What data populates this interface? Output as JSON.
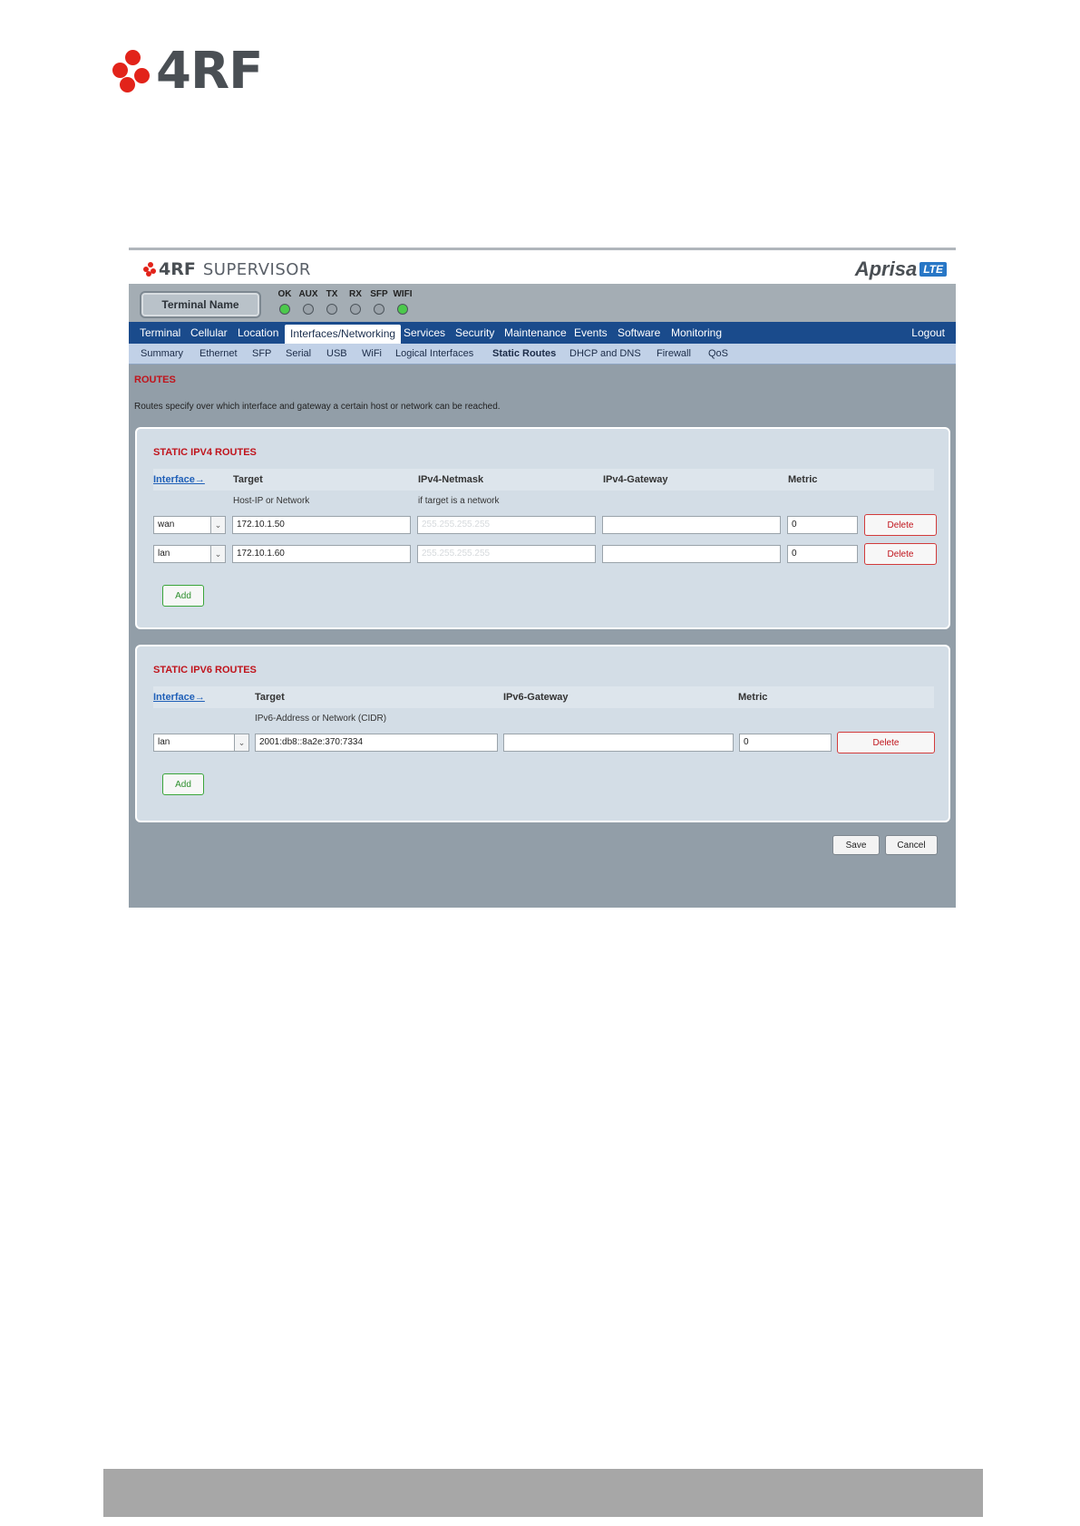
{
  "page_logo": {
    "text": "4RF"
  },
  "app": {
    "brand": "4RF",
    "product": "SUPERVISOR",
    "aprisa": "Aprisa",
    "aprisa_badge": "LTE"
  },
  "status": {
    "terminal_name": "Terminal Name",
    "leds": [
      {
        "label": "OK",
        "color": "#4cc94c"
      },
      {
        "label": "AUX",
        "color": "#9ba3aa"
      },
      {
        "label": "TX",
        "color": "#9ba3aa"
      },
      {
        "label": "RX",
        "color": "#9ba3aa"
      },
      {
        "label": "SFP",
        "color": "#9ba3aa"
      },
      {
        "label": "WIFI",
        "color": "#4cc94c"
      }
    ]
  },
  "nav": {
    "main": [
      "Terminal",
      "Cellular",
      "Location",
      "Interfaces/Networking",
      "Services",
      "Security",
      "Maintenance",
      "Events",
      "Software",
      "Monitoring"
    ],
    "logout": "Logout",
    "sub": [
      "Summary",
      "Ethernet",
      "SFP",
      "Serial",
      "USB",
      "WiFi",
      "Logical Interfaces",
      "Static Routes",
      "DHCP and DNS",
      "Firewall",
      "QoS"
    ]
  },
  "routes": {
    "title": "ROUTES",
    "description": "Routes specify over which interface and gateway a certain host or network can be reached."
  },
  "ipv4": {
    "title": "STATIC IPV4 ROUTES",
    "headers": {
      "interface": "Interface→",
      "target": "Target",
      "netmask": "IPv4-Netmask",
      "gateway": "IPv4-Gateway",
      "metric": "Metric"
    },
    "hints": {
      "target": "Host-IP or Network",
      "netmask": "if target is a network"
    },
    "rows": [
      {
        "interface": "wan",
        "target": "172.10.1.50",
        "netmask_placeholder": "255.255.255.255",
        "gateway": "",
        "metric": "0",
        "delete": "Delete"
      },
      {
        "interface": "lan",
        "target": "172.10.1.60",
        "netmask_placeholder": "255.255.255.255",
        "gateway": "",
        "metric": "0",
        "delete": "Delete"
      }
    ],
    "add": "Add"
  },
  "ipv6": {
    "title": "STATIC IPV6 ROUTES",
    "headers": {
      "interface": "Interface→",
      "target": "Target",
      "gateway": "IPv6-Gateway",
      "metric": "Metric"
    },
    "hints": {
      "target": "IPv6-Address or Network (CIDR)"
    },
    "rows": [
      {
        "interface": "lan",
        "target": "2001:db8::8a2e:370:7334",
        "gateway": "",
        "metric": "0",
        "delete": "Delete"
      }
    ],
    "add": "Add"
  },
  "actions": {
    "save": "Save",
    "cancel": "Cancel"
  }
}
